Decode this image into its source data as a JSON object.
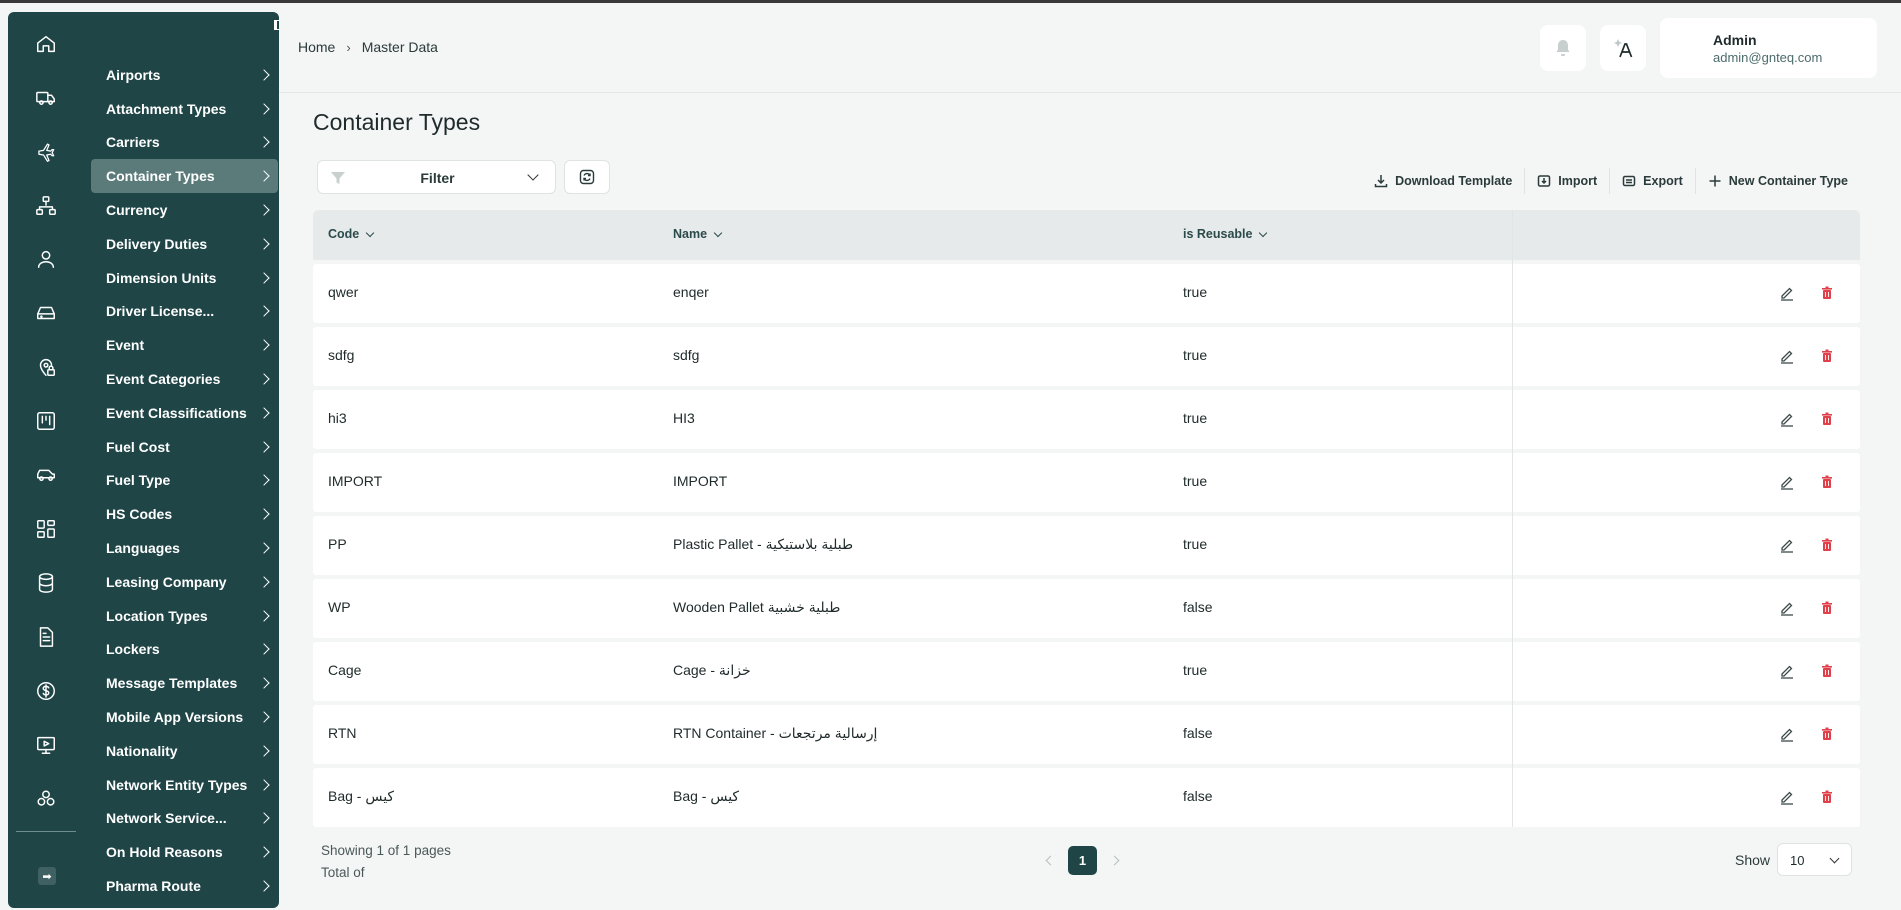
{
  "header": {
    "breadcrumb": [
      "Home",
      "Master Data"
    ],
    "user": {
      "name": "Admin",
      "email": "admin@gnteq.com"
    }
  },
  "sidebar": {
    "rail_icons": [
      "home-icon",
      "truck-icon",
      "plane-icon",
      "network-icon",
      "user-icon",
      "drive-icon",
      "location-lock-icon",
      "board-icon",
      "car-icon",
      "dashboard-icon",
      "database-icon",
      "document-icon",
      "dollar-icon",
      "presentation-icon",
      "shapes-icon"
    ],
    "items": [
      {
        "label": "Airports"
      },
      {
        "label": "Attachment Types"
      },
      {
        "label": "Carriers"
      },
      {
        "label": "Container Types",
        "active": true
      },
      {
        "label": "Currency"
      },
      {
        "label": "Delivery Duties"
      },
      {
        "label": "Dimension Units"
      },
      {
        "label": "Driver License..."
      },
      {
        "label": "Event"
      },
      {
        "label": "Event Categories"
      },
      {
        "label": "Event Classifications"
      },
      {
        "label": "Fuel Cost"
      },
      {
        "label": "Fuel Type"
      },
      {
        "label": "HS Codes"
      },
      {
        "label": "Languages"
      },
      {
        "label": "Leasing Company"
      },
      {
        "label": "Location Types"
      },
      {
        "label": "Lockers"
      },
      {
        "label": "Message Templates"
      },
      {
        "label": "Mobile App Versions"
      },
      {
        "label": "Nationality"
      },
      {
        "label": "Network Entity Types"
      },
      {
        "label": "Network Service..."
      },
      {
        "label": "On Hold Reasons"
      },
      {
        "label": "Pharma Route"
      }
    ]
  },
  "main": {
    "title": "Container Types",
    "filter_label": "Filter",
    "actions": {
      "download": "Download Template",
      "import": "Import",
      "export": "Export",
      "new": "New Container Type"
    },
    "columns": [
      "Code",
      "Name",
      "is Reusable"
    ],
    "rows": [
      {
        "code": "qwer",
        "name": "enqer",
        "reusable": "true"
      },
      {
        "code": "sdfg",
        "name": "sdfg",
        "reusable": "true"
      },
      {
        "code": "hi3",
        "name": "HI3",
        "reusable": "true"
      },
      {
        "code": "IMPORT",
        "name": "IMPORT",
        "reusable": "true"
      },
      {
        "code": "PP",
        "name": "Plastic Pallet - طبلية بلاستيكية",
        "reusable": "true"
      },
      {
        "code": "WP",
        "name": "Wooden Pallet طبلية خشبية",
        "reusable": "false"
      },
      {
        "code": "Cage",
        "name": "Cage - خزانة",
        "reusable": "true"
      },
      {
        "code": "RTN",
        "name": "RTN Container - إرسالية مرتجعات",
        "reusable": "false"
      },
      {
        "code": "Bag - كيس",
        "name": "Bag - كيس",
        "reusable": "false"
      }
    ],
    "pagination": {
      "showing": "Showing 1 of 1 pages",
      "total": "Total of",
      "current_page": "1",
      "show_label": "Show",
      "page_size": "10"
    }
  },
  "colors": {
    "sidebar": "#1f4547",
    "active_item": "#5b7b7b",
    "delete": "#e0404a"
  }
}
